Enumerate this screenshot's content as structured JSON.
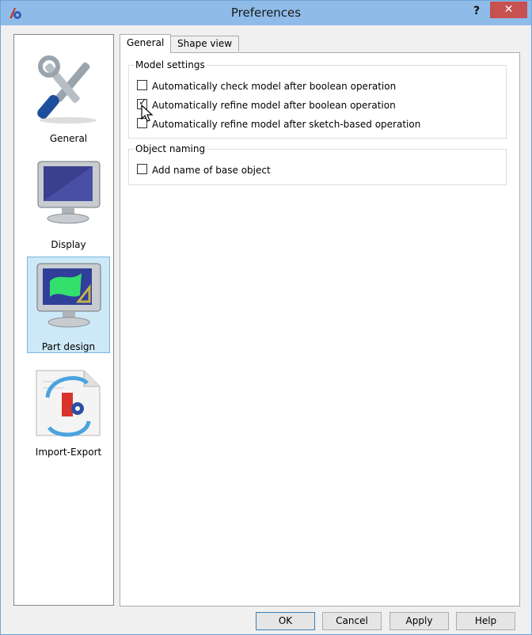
{
  "window": {
    "title": "Preferences",
    "help_symbol": "?",
    "close_symbol": "✕"
  },
  "sidebar": {
    "items": [
      {
        "label": "General",
        "icon": "tools-icon"
      },
      {
        "label": "Display",
        "icon": "monitor-icon"
      },
      {
        "label": "Part design",
        "icon": "part-design-icon",
        "active": true
      },
      {
        "label": "Import-Export",
        "icon": "import-export-icon"
      }
    ]
  },
  "tabs": [
    {
      "label": "General",
      "active": true
    },
    {
      "label": "Shape view",
      "active": false
    }
  ],
  "groups": {
    "model_settings": {
      "title": "Model settings",
      "options": [
        {
          "label": "Automatically check model after boolean operation",
          "checked": false
        },
        {
          "label": "Automatically refine model after boolean operation",
          "checked": true
        },
        {
          "label": "Automatically refine model after sketch-based operation",
          "checked": false
        }
      ]
    },
    "object_naming": {
      "title": "Object naming",
      "options": [
        {
          "label": "Add name of base object",
          "checked": false
        }
      ]
    }
  },
  "buttons": {
    "ok": "OK",
    "cancel": "Cancel",
    "apply": "Apply",
    "help": "Help"
  },
  "colors": {
    "titlebar": "#8fbbe9",
    "close": "#c75050",
    "selection": "#cde8f7"
  }
}
